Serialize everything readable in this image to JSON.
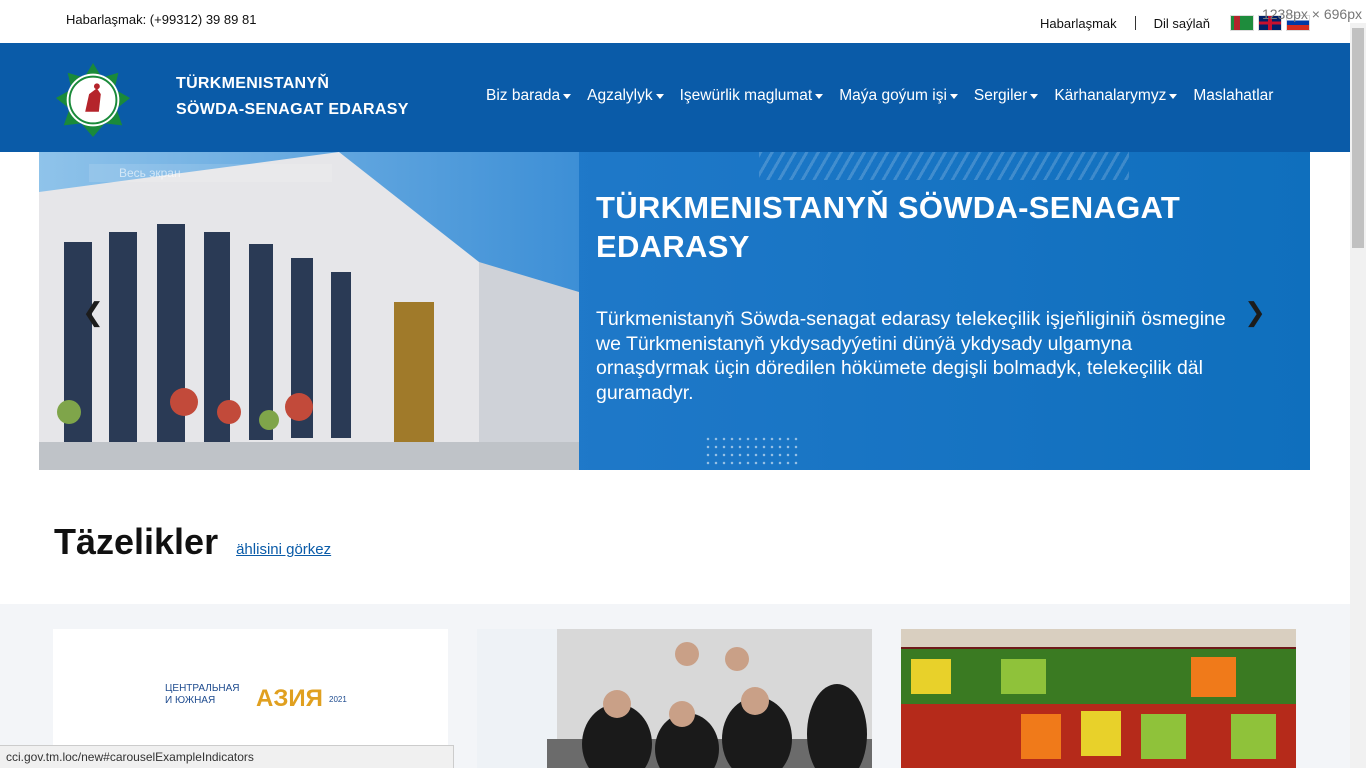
{
  "topbar": {
    "contact": "Habarlaşmak: (+99312) 39 89 81",
    "contact_link": "Habarlaşmak",
    "language": "Dil saýlaň",
    "dimensions": "1238px × 696px"
  },
  "navbar": {
    "brand_line1": "TÜRKMENISTANYŇ",
    "brand_line2": "SÖWDA-SENAGAT EDARASY",
    "menu": [
      {
        "label": "Biz barada",
        "dropdown": true
      },
      {
        "label": "Agzalylyk",
        "dropdown": true
      },
      {
        "label": "Işewürlik maglumat",
        "dropdown": true
      },
      {
        "label": "Maýa goýum işi",
        "dropdown": true
      },
      {
        "label": "Sergiler",
        "dropdown": true
      },
      {
        "label": "Kärhanalarymyz",
        "dropdown": true
      },
      {
        "label": "Maslahatlar",
        "dropdown": false
      }
    ]
  },
  "hero": {
    "fullscreen_label": "Весь экран",
    "title": "TÜRKMENISTANYŇ SÖWDA-SENAGAT EDARASY",
    "text": "Türkmenistanyň Söwda-senagat edarasy telekeçilik işjeňliginiň ösmegine we Türkmenistanyň ykdysadyýetini dünýä ykdysady ulgamyna ornaşdyrmak üçin döredilen hökümete degişli bolmadyk, telekeçilik däl guramadyr."
  },
  "news": {
    "title": "Täzelikler",
    "see_all": "ählisini görkez",
    "cards": [
      {
        "caption": "ЦЕНТРАЛЬНАЯ И ЮЖНАЯ АЗИЯ 2021"
      },
      {
        "caption": ""
      },
      {
        "caption": ""
      }
    ]
  },
  "status_url": "cci.gov.tm.loc/new#carouselExampleIndicators",
  "colors": {
    "navbar": "#0a5ba8",
    "hero": "#1e78c8"
  }
}
